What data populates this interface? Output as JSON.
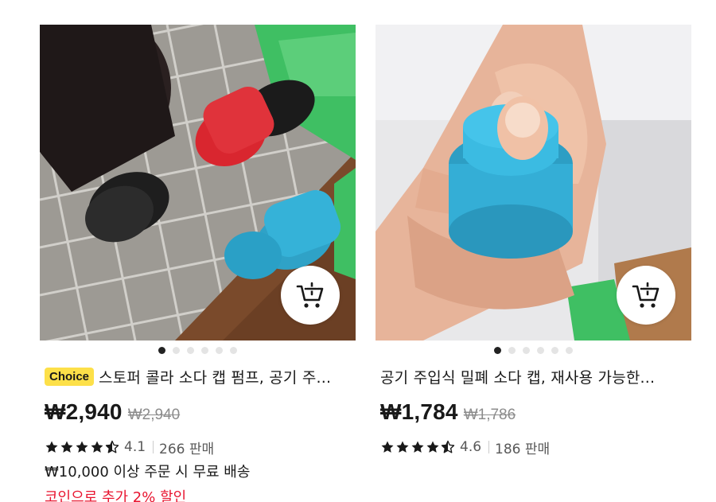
{
  "products": [
    {
      "badge": "Choice",
      "title": "스토퍼 콜라 소다 캡 펌프, 공기 주...",
      "price": "₩2,940",
      "original_price": "₩2,940",
      "rating": "4.1",
      "stars_filled": 4.5,
      "sold": "266 판매",
      "shipping": "₩10,000 이상 주문 시 무료 배송",
      "coin_discount": "코인으로 추가 2% 할인",
      "image_dots": 6,
      "active_dot": 0
    },
    {
      "title": "공기 주입식 밀폐 소다 캡, 재사용 가능한...",
      "price": "₩1,784",
      "original_price": "₩1,786",
      "rating": "4.6",
      "stars_filled": 4.5,
      "sold": "186 판매",
      "image_dots": 6,
      "active_dot": 0
    }
  ],
  "colors": {
    "choice_badge": "#fde049",
    "coin_text": "#e8142f",
    "price_text": "#191919",
    "muted_text": "#8c8c8c"
  },
  "icons": {
    "cart": "add-to-cart-icon",
    "star": "star-icon"
  }
}
